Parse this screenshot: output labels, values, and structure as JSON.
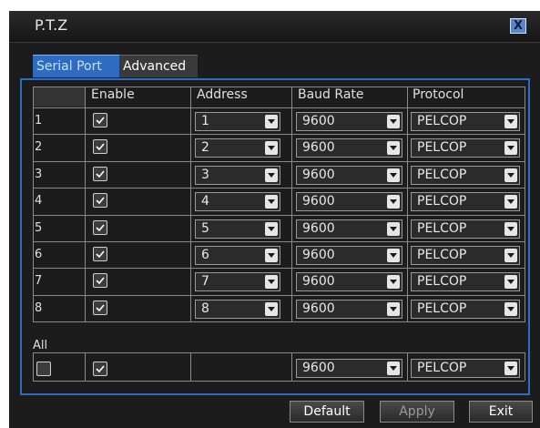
{
  "window": {
    "title": "P.T.Z",
    "close_label": "X"
  },
  "tabs": [
    {
      "label": "Serial Port",
      "active": true
    },
    {
      "label": "Advanced",
      "active": false
    }
  ],
  "table": {
    "columns": [
      "Enable",
      "Address",
      "Baud Rate",
      "Protocol"
    ],
    "rows": [
      {
        "channel": "1",
        "enabled": true,
        "address": "1",
        "baud_rate": "9600",
        "protocol": "PELCOP"
      },
      {
        "channel": "2",
        "enabled": true,
        "address": "2",
        "baud_rate": "9600",
        "protocol": "PELCOP"
      },
      {
        "channel": "3",
        "enabled": true,
        "address": "3",
        "baud_rate": "9600",
        "protocol": "PELCOP"
      },
      {
        "channel": "4",
        "enabled": true,
        "address": "4",
        "baud_rate": "9600",
        "protocol": "PELCOP"
      },
      {
        "channel": "5",
        "enabled": true,
        "address": "5",
        "baud_rate": "9600",
        "protocol": "PELCOP"
      },
      {
        "channel": "6",
        "enabled": true,
        "address": "6",
        "baud_rate": "9600",
        "protocol": "PELCOP"
      },
      {
        "channel": "7",
        "enabled": true,
        "address": "7",
        "baud_rate": "9600",
        "protocol": "PELCOP"
      },
      {
        "channel": "8",
        "enabled": true,
        "address": "8",
        "baud_rate": "9600",
        "protocol": "PELCOP"
      }
    ]
  },
  "all": {
    "label": "All",
    "select_all": false,
    "enabled": true,
    "baud_rate": "9600",
    "protocol": "PELCOP"
  },
  "buttons": {
    "default": "Default",
    "apply": "Apply",
    "exit": "Exit"
  },
  "colors": {
    "accent": "#2f6cc0",
    "background": "#1c1c1c",
    "grid": "#8a8a8a"
  }
}
